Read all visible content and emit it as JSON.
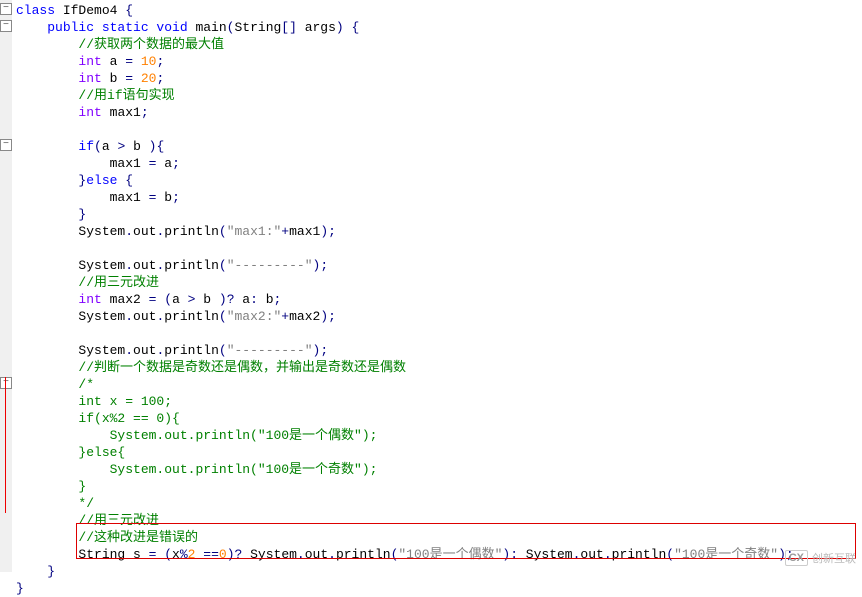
{
  "lines": [
    {
      "indent": 0,
      "tokens": [
        {
          "t": "class ",
          "c": "kw"
        },
        {
          "t": "IfDemo4 "
        },
        {
          "t": "{",
          "c": "pop-op"
        }
      ]
    },
    {
      "indent": 1,
      "tokens": [
        {
          "t": "public static void ",
          "c": "kw"
        },
        {
          "t": "main"
        },
        {
          "t": "(",
          "c": "pop-op"
        },
        {
          "t": "String"
        },
        {
          "t": "[] ",
          "c": "pop-op"
        },
        {
          "t": "args"
        },
        {
          "t": ") {",
          "c": "pop-op"
        }
      ]
    },
    {
      "indent": 2,
      "tokens": [
        {
          "t": "//获取两个数据的最大值",
          "c": "cmt"
        }
      ]
    },
    {
      "indent": 2,
      "tokens": [
        {
          "t": "int ",
          "c": "type"
        },
        {
          "t": "a "
        },
        {
          "t": "= ",
          "c": "pop-op"
        },
        {
          "t": "10",
          "c": "num"
        },
        {
          "t": ";",
          "c": "pop-op"
        }
      ]
    },
    {
      "indent": 2,
      "tokens": [
        {
          "t": "int ",
          "c": "type"
        },
        {
          "t": "b "
        },
        {
          "t": "= ",
          "c": "pop-op"
        },
        {
          "t": "20",
          "c": "num"
        },
        {
          "t": ";",
          "c": "pop-op"
        }
      ]
    },
    {
      "indent": 2,
      "tokens": [
        {
          "t": "//用if语句实现",
          "c": "cmt"
        }
      ]
    },
    {
      "indent": 2,
      "tokens": [
        {
          "t": "int ",
          "c": "type"
        },
        {
          "t": "max1"
        },
        {
          "t": ";",
          "c": "pop-op"
        }
      ]
    },
    {
      "indent": 2,
      "tokens": []
    },
    {
      "indent": 2,
      "tokens": [
        {
          "t": "if",
          "c": "kw"
        },
        {
          "t": "(",
          "c": "pop-op"
        },
        {
          "t": "a "
        },
        {
          "t": "> ",
          "c": "pop-op"
        },
        {
          "t": "b "
        },
        {
          "t": "){",
          "c": "pop-op"
        }
      ]
    },
    {
      "indent": 3,
      "tokens": [
        {
          "t": "max1 "
        },
        {
          "t": "= ",
          "c": "pop-op"
        },
        {
          "t": "a"
        },
        {
          "t": ";",
          "c": "pop-op"
        }
      ]
    },
    {
      "indent": 2,
      "tokens": [
        {
          "t": "}",
          "c": "pop-op"
        },
        {
          "t": "else ",
          "c": "kw"
        },
        {
          "t": "{",
          "c": "pop-op"
        }
      ]
    },
    {
      "indent": 3,
      "tokens": [
        {
          "t": "max1 "
        },
        {
          "t": "= ",
          "c": "pop-op"
        },
        {
          "t": "b"
        },
        {
          "t": ";",
          "c": "pop-op"
        }
      ]
    },
    {
      "indent": 2,
      "tokens": [
        {
          "t": "}",
          "c": "pop-op"
        }
      ]
    },
    {
      "indent": 2,
      "tokens": [
        {
          "t": "System"
        },
        {
          "t": ".",
          "c": "pop-op"
        },
        {
          "t": "out"
        },
        {
          "t": ".",
          "c": "pop-op"
        },
        {
          "t": "println"
        },
        {
          "t": "(",
          "c": "pop-op"
        },
        {
          "t": "\"max1:\"",
          "c": "str"
        },
        {
          "t": "+",
          "c": "pop-op"
        },
        {
          "t": "max1"
        },
        {
          "t": ");",
          "c": "pop-op"
        }
      ]
    },
    {
      "indent": 2,
      "tokens": []
    },
    {
      "indent": 2,
      "tokens": [
        {
          "t": "System"
        },
        {
          "t": ".",
          "c": "pop-op"
        },
        {
          "t": "out"
        },
        {
          "t": ".",
          "c": "pop-op"
        },
        {
          "t": "println"
        },
        {
          "t": "(",
          "c": "pop-op"
        },
        {
          "t": "\"---------\"",
          "c": "str"
        },
        {
          "t": ");",
          "c": "pop-op"
        }
      ]
    },
    {
      "indent": 2,
      "tokens": [
        {
          "t": "//用三元改进",
          "c": "cmt"
        }
      ]
    },
    {
      "indent": 2,
      "tokens": [
        {
          "t": "int ",
          "c": "type"
        },
        {
          "t": "max2 "
        },
        {
          "t": "= (",
          "c": "pop-op"
        },
        {
          "t": "a "
        },
        {
          "t": "> ",
          "c": "pop-op"
        },
        {
          "t": "b "
        },
        {
          "t": ")? ",
          "c": "pop-op"
        },
        {
          "t": "a"
        },
        {
          "t": ": ",
          "c": "pop-op"
        },
        {
          "t": "b"
        },
        {
          "t": ";",
          "c": "pop-op"
        }
      ]
    },
    {
      "indent": 2,
      "tokens": [
        {
          "t": "System"
        },
        {
          "t": ".",
          "c": "pop-op"
        },
        {
          "t": "out"
        },
        {
          "t": ".",
          "c": "pop-op"
        },
        {
          "t": "println"
        },
        {
          "t": "(",
          "c": "pop-op"
        },
        {
          "t": "\"max2:\"",
          "c": "str"
        },
        {
          "t": "+",
          "c": "pop-op"
        },
        {
          "t": "max2"
        },
        {
          "t": ");",
          "c": "pop-op"
        }
      ]
    },
    {
      "indent": 2,
      "tokens": []
    },
    {
      "indent": 2,
      "tokens": [
        {
          "t": "System"
        },
        {
          "t": ".",
          "c": "pop-op"
        },
        {
          "t": "out"
        },
        {
          "t": ".",
          "c": "pop-op"
        },
        {
          "t": "println"
        },
        {
          "t": "(",
          "c": "pop-op"
        },
        {
          "t": "\"---------\"",
          "c": "str"
        },
        {
          "t": ");",
          "c": "pop-op"
        }
      ]
    },
    {
      "indent": 2,
      "tokens": [
        {
          "t": "//判断一个数据是奇数还是偶数，并输出是奇数还是偶数",
          "c": "cmt"
        }
      ]
    },
    {
      "indent": 2,
      "tokens": [
        {
          "t": "/*",
          "c": "cmt"
        }
      ]
    },
    {
      "indent": 2,
      "tokens": [
        {
          "t": "int x = 100;",
          "c": "cmt"
        }
      ]
    },
    {
      "indent": 2,
      "tokens": [
        {
          "t": "if(x%2 == 0){",
          "c": "cmt"
        }
      ]
    },
    {
      "indent": 3,
      "tokens": [
        {
          "t": "System.out.println(\"100是一个偶数\");",
          "c": "cmt"
        }
      ]
    },
    {
      "indent": 2,
      "tokens": [
        {
          "t": "}else{",
          "c": "cmt"
        }
      ]
    },
    {
      "indent": 3,
      "tokens": [
        {
          "t": "System.out.println(\"100是一个奇数\");",
          "c": "cmt"
        }
      ]
    },
    {
      "indent": 2,
      "tokens": [
        {
          "t": "}",
          "c": "cmt"
        }
      ]
    },
    {
      "indent": 2,
      "tokens": [
        {
          "t": "*/",
          "c": "cmt"
        }
      ]
    },
    {
      "indent": 2,
      "tokens": [
        {
          "t": "//用三元改进",
          "c": "cmt"
        }
      ]
    },
    {
      "indent": 2,
      "tokens": [
        {
          "t": "//这种改进是错误的",
          "c": "cmt"
        }
      ]
    },
    {
      "indent": 2,
      "tokens": [
        {
          "t": "String s "
        },
        {
          "t": "= (",
          "c": "pop-op"
        },
        {
          "t": "x"
        },
        {
          "t": "%",
          "c": "pop-op"
        },
        {
          "t": "2",
          "c": "num"
        },
        {
          "t": " ==",
          "c": "pop-op"
        },
        {
          "t": "0",
          "c": "num"
        },
        {
          "t": ")? ",
          "c": "pop-op"
        },
        {
          "t": "System"
        },
        {
          "t": ".",
          "c": "pop-op"
        },
        {
          "t": "out"
        },
        {
          "t": ".",
          "c": "pop-op"
        },
        {
          "t": "println"
        },
        {
          "t": "(",
          "c": "pop-op"
        },
        {
          "t": "\"100是一个偶数\"",
          "c": "str"
        },
        {
          "t": "): ",
          "c": "pop-op"
        },
        {
          "t": "System"
        },
        {
          "t": ".",
          "c": "pop-op"
        },
        {
          "t": "out"
        },
        {
          "t": ".",
          "c": "pop-op"
        },
        {
          "t": "println"
        },
        {
          "t": "(",
          "c": "pop-op"
        },
        {
          "t": "\"100是一个奇数\"",
          "c": "str"
        },
        {
          "t": ");",
          "c": "pop-op"
        }
      ]
    },
    {
      "indent": 1,
      "tokens": [
        {
          "t": "}",
          "c": "pop-op"
        }
      ]
    },
    {
      "indent": 0,
      "tokens": [
        {
          "t": "}",
          "c": "pop-op"
        }
      ]
    }
  ],
  "folds": [
    {
      "line": 0,
      "sym": "−"
    },
    {
      "line": 1,
      "sym": "−"
    },
    {
      "line": 8,
      "sym": "−"
    },
    {
      "line": 22,
      "sym": "−"
    }
  ],
  "watermark": "创新互联"
}
